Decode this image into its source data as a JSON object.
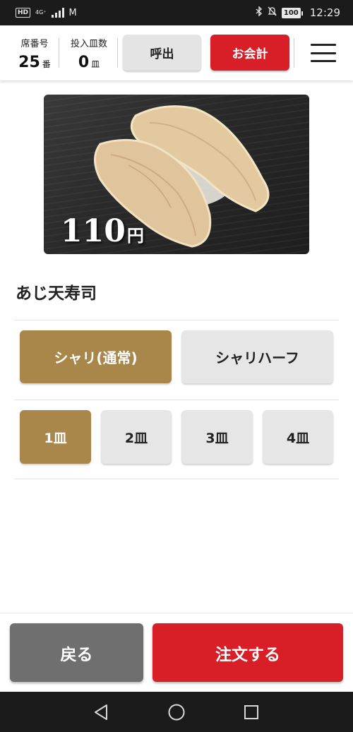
{
  "status_bar": {
    "left_badge": "HD",
    "network": "4G⁺",
    "battery": "100",
    "time": "12:29"
  },
  "header": {
    "seat_label": "席番号",
    "seat_number": "25",
    "seat_unit": "番",
    "plates_label": "投入皿数",
    "plates_count": "0",
    "plates_unit": "皿",
    "call_button": "呼出",
    "pay_button": "お会計"
  },
  "product": {
    "price": "110",
    "currency": "円",
    "name": "あじ天寿司"
  },
  "rice_options": [
    {
      "label": "シャリ(通常)",
      "selected": true
    },
    {
      "label": "シャリハーフ",
      "selected": false
    }
  ],
  "quantity_options": [
    {
      "label": "1皿",
      "selected": true
    },
    {
      "label": "2皿",
      "selected": false
    },
    {
      "label": "3皿",
      "selected": false
    },
    {
      "label": "4皿",
      "selected": false
    }
  ],
  "footer": {
    "back_button": "戻る",
    "order_button": "注文する"
  },
  "colors": {
    "accent_red": "#d81e27",
    "selected_gold": "#a9864a",
    "unselected_gray": "#e6e6e6",
    "back_gray": "#6f6f6f"
  },
  "icons": {
    "menu": "hamburger-icon",
    "nav_back": "triangle-back-icon",
    "nav_home": "circle-home-icon",
    "nav_recents": "square-recents-icon"
  }
}
